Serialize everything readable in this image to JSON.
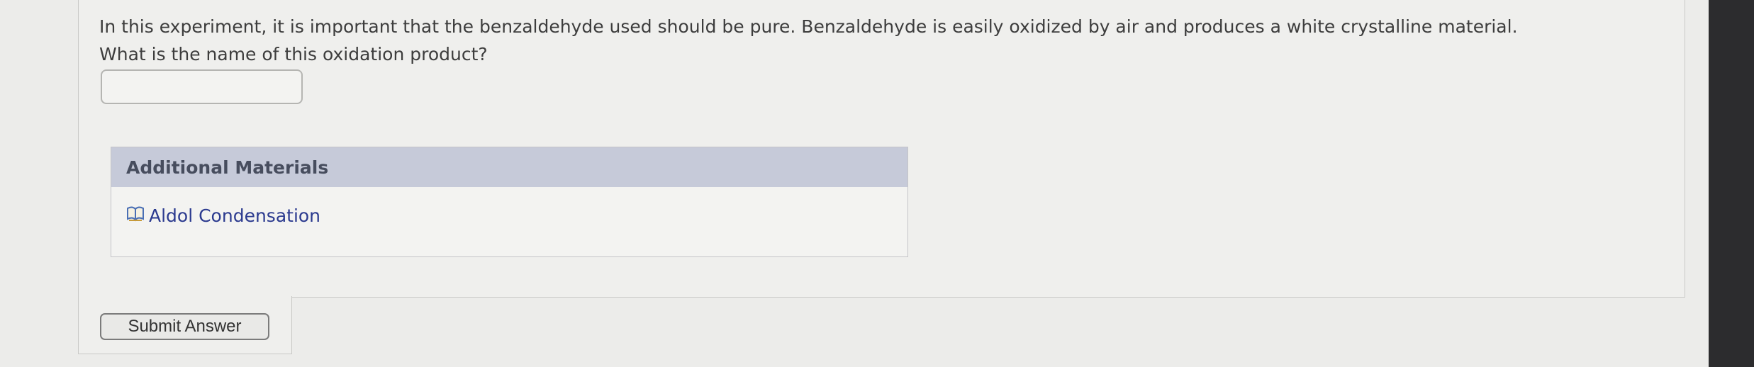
{
  "question": {
    "line1": "In this experiment, it is important that the benzaldehyde used should be pure. Benzaldehyde is easily oxidized by air and produces a white crystalline material.",
    "line2": "What is the name of this oxidation product?",
    "answer_value": ""
  },
  "additional_materials": {
    "header": "Additional Materials",
    "items": [
      {
        "label": "Aldol Condensation",
        "icon": "book-icon"
      }
    ]
  },
  "submit": {
    "label": "Submit Answer"
  },
  "colors": {
    "link": "#2b3a8f",
    "header_bg": "#c6cad9",
    "background": "#ececea"
  }
}
